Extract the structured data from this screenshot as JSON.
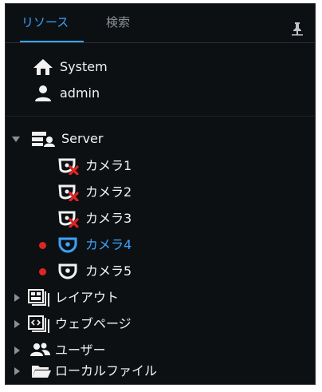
{
  "tabs": [
    {
      "label": "リソース",
      "active": true
    },
    {
      "label": "検索",
      "active": false
    }
  ],
  "user_section": {
    "system_label": "System",
    "user_label": "admin"
  },
  "tree": {
    "server_label": "Server",
    "cameras": [
      {
        "label": "カメラ1",
        "status": "offline"
      },
      {
        "label": "カメラ2",
        "status": "offline"
      },
      {
        "label": "カメラ3",
        "status": "offline"
      },
      {
        "label": "カメラ4",
        "status": "recording",
        "selected": true
      },
      {
        "label": "カメラ5",
        "status": "recording",
        "selected": false
      }
    ],
    "groups": [
      {
        "label": "レイアウト",
        "icon": "layout-icon"
      },
      {
        "label": "ウェブページ",
        "icon": "webpage-icon"
      },
      {
        "label": "ユーザー",
        "icon": "users-icon"
      },
      {
        "label": "ローカルファイル",
        "icon": "folder-icon"
      }
    ]
  },
  "colors": {
    "accent": "#3aa3ff",
    "recording": "#e02424",
    "background": "#0d1013"
  }
}
